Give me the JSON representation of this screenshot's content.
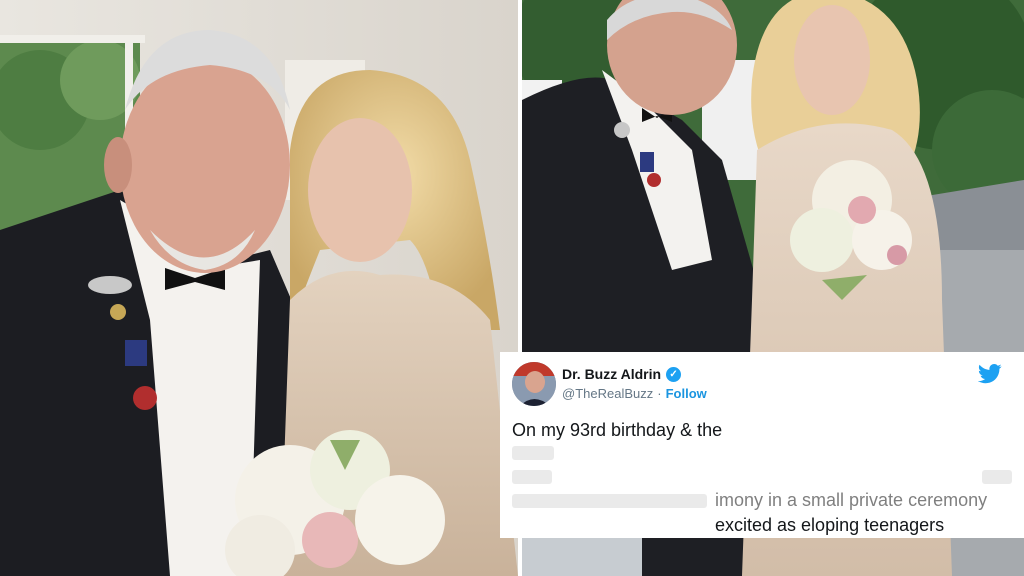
{
  "tweet": {
    "display_name": "Dr. Buzz Aldrin",
    "handle": "@TheRealBuzz",
    "separator": "·",
    "follow_label": "Follow",
    "text_line_1": "On my 93rd birthday & the",
    "text_line_4_fragment": "imony in a small private ceremony",
    "text_line_5": "excited as eloping teenagers"
  },
  "icons": {
    "verified": "verified-badge-icon",
    "brand": "twitter-bird-icon"
  },
  "colors": {
    "twitter_blue": "#1da1f2",
    "follow_link": "#1b95e0",
    "tuxedo": "#1c1d22",
    "dress": "#d8c4ae"
  }
}
